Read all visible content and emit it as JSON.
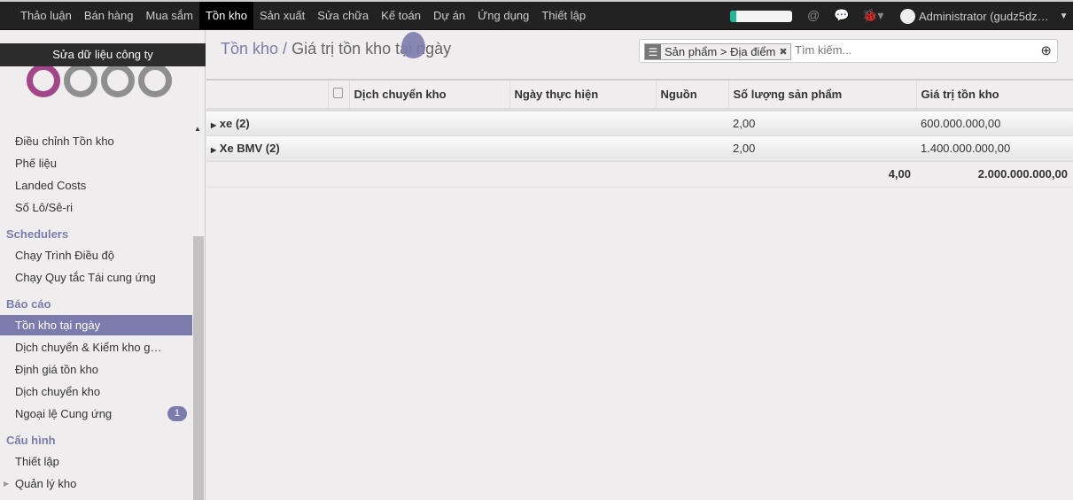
{
  "navbar": {
    "menu": [
      "Thảo luận",
      "Bán hàng",
      "Mua sắm",
      "Tồn kho",
      "Sản xuất",
      "Sửa chữa",
      "Kế toán",
      "Dự án",
      "Ứng dụng",
      "Thiết lập"
    ],
    "active": "Tồn kho",
    "progress_percent": 10,
    "user": "Administrator (gudz5dz…"
  },
  "sidebar": {
    "company_button": "Sửa dữ liệu công ty",
    "items_top": [
      "Điều chỉnh Tồn kho",
      "Phế liệu",
      "Landed Costs",
      "Số Lô/Sê-ri"
    ],
    "schedulers": {
      "title": "Schedulers",
      "items": [
        "Chạy Trình Điều độ",
        "Chạy Quy tắc Tái cung ứng"
      ]
    },
    "reports": {
      "title": "Báo cáo",
      "items": [
        "Tồn kho tại ngày",
        "Dịch chuyển & Kiểm kho g…",
        "Định giá tồn kho",
        "Dịch chuyển kho",
        "Ngoại lệ Cung ứng"
      ],
      "badge": "1"
    },
    "config": {
      "title": "Cấu hình",
      "items": [
        "Thiết lập",
        "Quản lý kho"
      ]
    }
  },
  "breadcrumb": {
    "parent": "Tồn kho /",
    "current": "Giá trị tồn kho tại ngày"
  },
  "search": {
    "facet": "Sản phẩm > Địa điểm",
    "placeholder": "Tìm kiếm..."
  },
  "table": {
    "headers": [
      "Dịch chuyển kho",
      "Ngày thực hiện",
      "Nguồn",
      "Số lượng sản phẩm",
      "Giá trị tồn kho"
    ],
    "groups": [
      {
        "label": "xe (2)",
        "qty": "2,00",
        "value": "600.000.000,00"
      },
      {
        "label": "Xe BMV (2)",
        "qty": "2,00",
        "value": "1.400.000.000,00"
      }
    ],
    "totals": {
      "qty": "4,00",
      "value": "2.000.000.000,00"
    }
  }
}
